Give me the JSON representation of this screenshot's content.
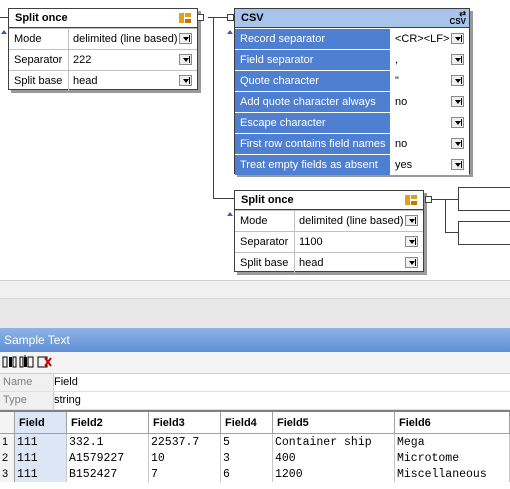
{
  "split1": {
    "title": "Split once",
    "rows": [
      {
        "label": "Mode",
        "value": "delimited (line based)"
      },
      {
        "label": "Separator",
        "value": "222"
      },
      {
        "label": "Split base",
        "value": "head"
      }
    ]
  },
  "csv": {
    "title": "CSV",
    "icon_text": "CSV",
    "rows": [
      {
        "label": "Record separator",
        "value": "<CR><LF>"
      },
      {
        "label": "Field separator",
        "value": ","
      },
      {
        "label": "Quote character",
        "value": "\""
      },
      {
        "label": "Add quote character always",
        "value": "no"
      },
      {
        "label": "Escape character",
        "value": ""
      },
      {
        "label": "First row contains field names",
        "value": "no"
      },
      {
        "label": "Treat empty fields as absent",
        "value": "yes"
      }
    ]
  },
  "split2": {
    "title": "Split once",
    "rows": [
      {
        "label": "Mode",
        "value": "delimited (line based)"
      },
      {
        "label": "Separator",
        "value": "1100"
      },
      {
        "label": "Split base",
        "value": "head"
      }
    ]
  },
  "panel": {
    "title": "Sample Text",
    "name_key": "Name",
    "name_value": "Field",
    "type_key": "Type",
    "type_value": "string"
  },
  "grid": {
    "headers": [
      "Field",
      "Field2",
      "Field3",
      "Field4",
      "Field5",
      "Field6"
    ],
    "rows": [
      {
        "n": "1",
        "cells": [
          "111",
          "332.1",
          "22537.7",
          "5",
          "Container ship",
          "Mega"
        ]
      },
      {
        "n": "2",
        "cells": [
          "111",
          "A1579227",
          "10",
          "3",
          "400",
          "Microtome"
        ]
      },
      {
        "n": "3",
        "cells": [
          "111",
          "B152427",
          "7",
          "6",
          "1200",
          "Miscellaneous"
        ]
      }
    ]
  },
  "colors": {
    "csv_header": "#a9c4ea",
    "csv_rows": "#4f7fd0",
    "panel_title": "#6f9bd9"
  }
}
